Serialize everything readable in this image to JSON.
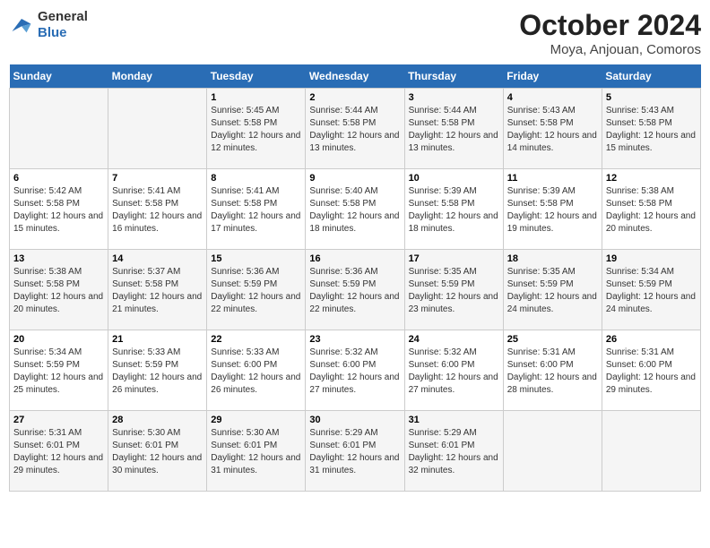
{
  "header": {
    "logo": {
      "general": "General",
      "blue": "Blue"
    },
    "title": "October 2024",
    "subtitle": "Moya, Anjouan, Comoros"
  },
  "weekdays": [
    "Sunday",
    "Monday",
    "Tuesday",
    "Wednesday",
    "Thursday",
    "Friday",
    "Saturday"
  ],
  "weeks": [
    [
      {
        "day": "",
        "info": ""
      },
      {
        "day": "",
        "info": ""
      },
      {
        "day": "1",
        "info": "Sunrise: 5:45 AM\nSunset: 5:58 PM\nDaylight: 12 hours and 12 minutes."
      },
      {
        "day": "2",
        "info": "Sunrise: 5:44 AM\nSunset: 5:58 PM\nDaylight: 12 hours and 13 minutes."
      },
      {
        "day": "3",
        "info": "Sunrise: 5:44 AM\nSunset: 5:58 PM\nDaylight: 12 hours and 13 minutes."
      },
      {
        "day": "4",
        "info": "Sunrise: 5:43 AM\nSunset: 5:58 PM\nDaylight: 12 hours and 14 minutes."
      },
      {
        "day": "5",
        "info": "Sunrise: 5:43 AM\nSunset: 5:58 PM\nDaylight: 12 hours and 15 minutes."
      }
    ],
    [
      {
        "day": "6",
        "info": "Sunrise: 5:42 AM\nSunset: 5:58 PM\nDaylight: 12 hours and 15 minutes."
      },
      {
        "day": "7",
        "info": "Sunrise: 5:41 AM\nSunset: 5:58 PM\nDaylight: 12 hours and 16 minutes."
      },
      {
        "day": "8",
        "info": "Sunrise: 5:41 AM\nSunset: 5:58 PM\nDaylight: 12 hours and 17 minutes."
      },
      {
        "day": "9",
        "info": "Sunrise: 5:40 AM\nSunset: 5:58 PM\nDaylight: 12 hours and 18 minutes."
      },
      {
        "day": "10",
        "info": "Sunrise: 5:39 AM\nSunset: 5:58 PM\nDaylight: 12 hours and 18 minutes."
      },
      {
        "day": "11",
        "info": "Sunrise: 5:39 AM\nSunset: 5:58 PM\nDaylight: 12 hours and 19 minutes."
      },
      {
        "day": "12",
        "info": "Sunrise: 5:38 AM\nSunset: 5:58 PM\nDaylight: 12 hours and 20 minutes."
      }
    ],
    [
      {
        "day": "13",
        "info": "Sunrise: 5:38 AM\nSunset: 5:58 PM\nDaylight: 12 hours and 20 minutes."
      },
      {
        "day": "14",
        "info": "Sunrise: 5:37 AM\nSunset: 5:58 PM\nDaylight: 12 hours and 21 minutes."
      },
      {
        "day": "15",
        "info": "Sunrise: 5:36 AM\nSunset: 5:59 PM\nDaylight: 12 hours and 22 minutes."
      },
      {
        "day": "16",
        "info": "Sunrise: 5:36 AM\nSunset: 5:59 PM\nDaylight: 12 hours and 22 minutes."
      },
      {
        "day": "17",
        "info": "Sunrise: 5:35 AM\nSunset: 5:59 PM\nDaylight: 12 hours and 23 minutes."
      },
      {
        "day": "18",
        "info": "Sunrise: 5:35 AM\nSunset: 5:59 PM\nDaylight: 12 hours and 24 minutes."
      },
      {
        "day": "19",
        "info": "Sunrise: 5:34 AM\nSunset: 5:59 PM\nDaylight: 12 hours and 24 minutes."
      }
    ],
    [
      {
        "day": "20",
        "info": "Sunrise: 5:34 AM\nSunset: 5:59 PM\nDaylight: 12 hours and 25 minutes."
      },
      {
        "day": "21",
        "info": "Sunrise: 5:33 AM\nSunset: 5:59 PM\nDaylight: 12 hours and 26 minutes."
      },
      {
        "day": "22",
        "info": "Sunrise: 5:33 AM\nSunset: 6:00 PM\nDaylight: 12 hours and 26 minutes."
      },
      {
        "day": "23",
        "info": "Sunrise: 5:32 AM\nSunset: 6:00 PM\nDaylight: 12 hours and 27 minutes."
      },
      {
        "day": "24",
        "info": "Sunrise: 5:32 AM\nSunset: 6:00 PM\nDaylight: 12 hours and 27 minutes."
      },
      {
        "day": "25",
        "info": "Sunrise: 5:31 AM\nSunset: 6:00 PM\nDaylight: 12 hours and 28 minutes."
      },
      {
        "day": "26",
        "info": "Sunrise: 5:31 AM\nSunset: 6:00 PM\nDaylight: 12 hours and 29 minutes."
      }
    ],
    [
      {
        "day": "27",
        "info": "Sunrise: 5:31 AM\nSunset: 6:01 PM\nDaylight: 12 hours and 29 minutes."
      },
      {
        "day": "28",
        "info": "Sunrise: 5:30 AM\nSunset: 6:01 PM\nDaylight: 12 hours and 30 minutes."
      },
      {
        "day": "29",
        "info": "Sunrise: 5:30 AM\nSunset: 6:01 PM\nDaylight: 12 hours and 31 minutes."
      },
      {
        "day": "30",
        "info": "Sunrise: 5:29 AM\nSunset: 6:01 PM\nDaylight: 12 hours and 31 minutes."
      },
      {
        "day": "31",
        "info": "Sunrise: 5:29 AM\nSunset: 6:01 PM\nDaylight: 12 hours and 32 minutes."
      },
      {
        "day": "",
        "info": ""
      },
      {
        "day": "",
        "info": ""
      }
    ]
  ]
}
